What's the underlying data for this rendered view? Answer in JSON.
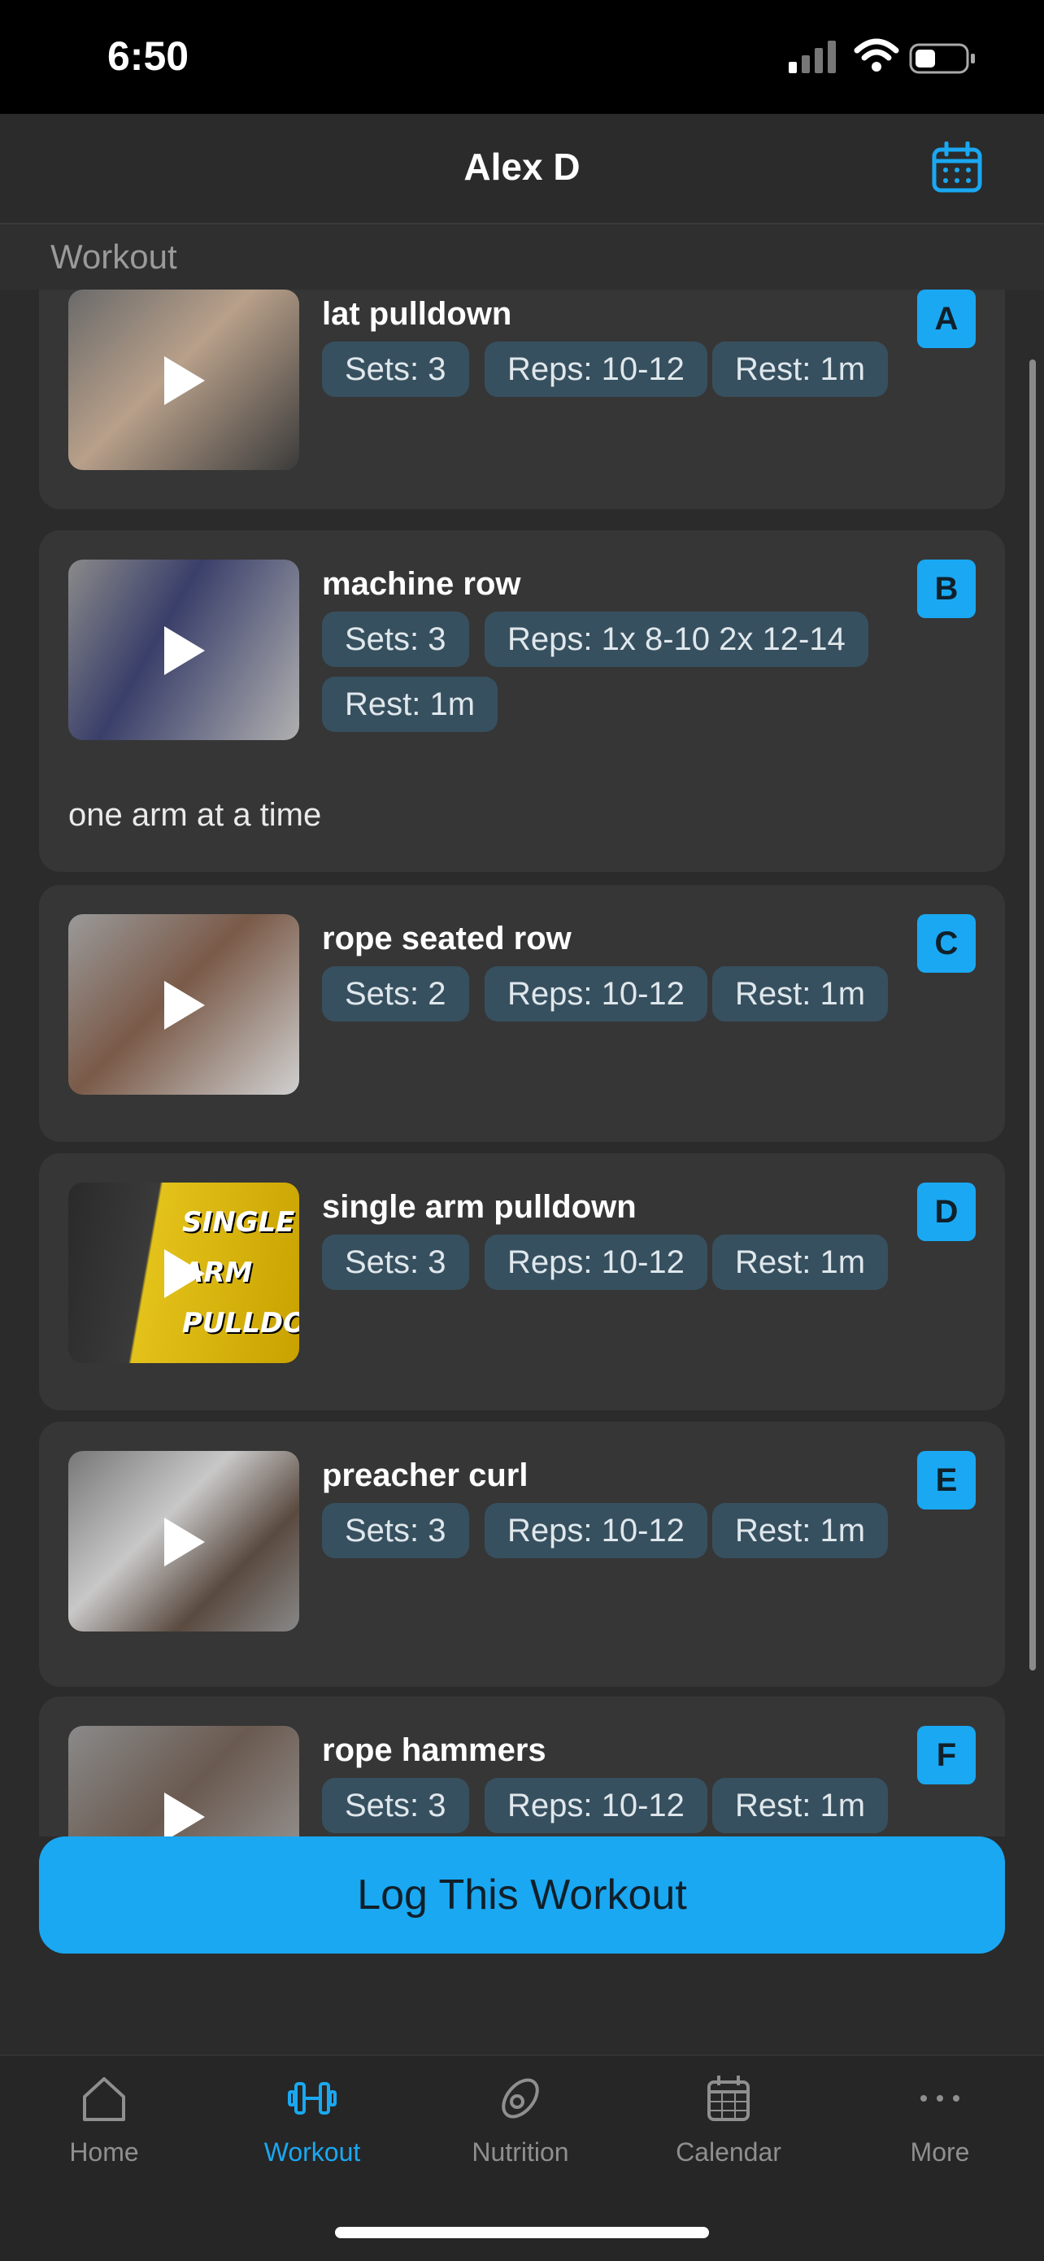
{
  "status_bar": {
    "time": "6:50"
  },
  "header": {
    "title": "Alex D",
    "calendar_icon": "calendar-icon"
  },
  "section": {
    "label": "Workout"
  },
  "exercises": [
    {
      "letter": "A",
      "name": "lat pulldown",
      "sets": "Sets: 3",
      "reps": "Reps: 10-12",
      "rest": "Rest: 1m",
      "note": ""
    },
    {
      "letter": "B",
      "name": "machine row",
      "sets": "Sets: 3",
      "reps": "Reps: 1x 8-10  2x 12-14",
      "rest": "Rest: 1m",
      "note": "one arm at a time"
    },
    {
      "letter": "C",
      "name": "rope seated row",
      "sets": "Sets: 2",
      "reps": "Reps: 10-12",
      "rest": "Rest: 1m",
      "note": ""
    },
    {
      "letter": "D",
      "name": "single arm pulldown",
      "sets": "Sets: 3",
      "reps": "Reps: 10-12",
      "rest": "Rest: 1m",
      "note": "",
      "thumb_text": "SINGLE ARM PULLDOWN"
    },
    {
      "letter": "E",
      "name": "preacher curl",
      "sets": "Sets: 3",
      "reps": "Reps: 10-12",
      "rest": "Rest: 1m",
      "note": ""
    },
    {
      "letter": "F",
      "name": "rope hammers",
      "sets": "Sets: 3",
      "reps": "Reps: 10-12",
      "rest": "Rest: 1m",
      "note": ""
    }
  ],
  "actions": {
    "log_workout": "Log This Workout"
  },
  "tabs": [
    {
      "label": "Home",
      "icon": "home-icon"
    },
    {
      "label": "Workout",
      "icon": "dumbbell-icon",
      "active": true
    },
    {
      "label": "Nutrition",
      "icon": "avocado-icon"
    },
    {
      "label": "Calendar",
      "icon": "calendar-icon"
    },
    {
      "label": "More",
      "icon": "more-icon"
    }
  ],
  "colors": {
    "accent": "#1aa8f2",
    "background": "#2b2b2b",
    "card": "#363636",
    "chip": "#37505f"
  }
}
